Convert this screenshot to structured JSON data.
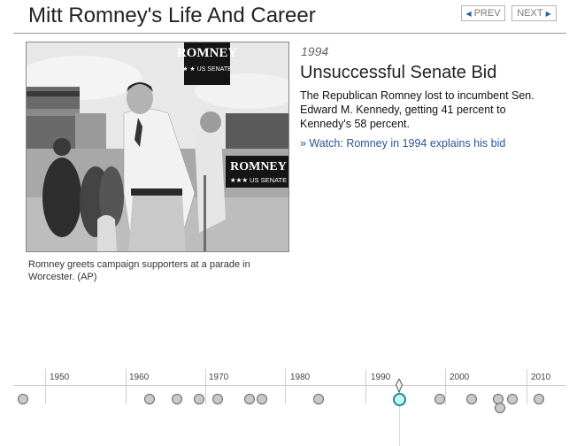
{
  "header": {
    "title": "Mitt Romney's Life And Career",
    "prev_label": "PREV",
    "next_label": "NEXT"
  },
  "photo": {
    "caption": "Romney greets campaign supporters at a parade in Worcester. (AP)",
    "sign_top": "ROMNEY",
    "sign_top_sub": "★ ★ US SENATE",
    "sign_right": "ROMNEY",
    "sign_right_sub": "★★★ US SENATE"
  },
  "entry": {
    "year": "1994",
    "headline": "Unsuccessful Senate Bid",
    "description": "The Republican Romney lost to incumbent Sen. Edward M. Kennedy, getting 41 percent to Kennedy's 58 percent.",
    "link": "» Watch: Romney in 1994 explains his bid"
  },
  "timeline": {
    "ticks": [
      "1950",
      "1960",
      "1970",
      "1980",
      "1990",
      "2000",
      "2010"
    ]
  }
}
